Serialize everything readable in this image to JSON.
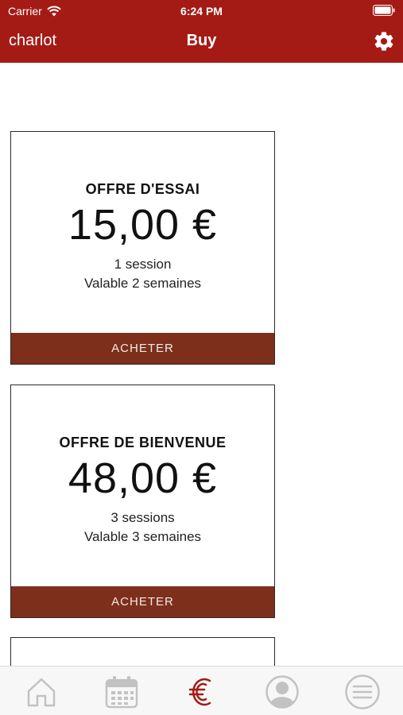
{
  "status_bar": {
    "carrier": "Carrier",
    "time": "6:24 PM",
    "icons": [
      "wifi-icon",
      "battery-icon"
    ]
  },
  "nav": {
    "left_label": "charlot",
    "title": "Buy",
    "settings_icon": "gear-icon"
  },
  "colors": {
    "header": "#a41b15",
    "button": "#7d2f1c",
    "tab_active": "#a41b15",
    "tab_inactive": "#c2c2c2"
  },
  "offers": [
    {
      "title": "OFFRE D'ESSAI",
      "price": "15,00 €",
      "sessions": "1 session",
      "validity": "Valable 2 semaines",
      "button": "ACHETER"
    },
    {
      "title": "OFFRE DE BIENVENUE",
      "price": "48,00 €",
      "sessions": "3 sessions",
      "validity": "Valable 3 semaines",
      "button": "ACHETER"
    }
  ],
  "tab_bar": {
    "tabs": [
      {
        "icon": "home-icon",
        "active": false
      },
      {
        "icon": "calendar-icon",
        "active": false
      },
      {
        "icon": "euro-icon",
        "active": true
      },
      {
        "icon": "profile-icon",
        "active": false
      },
      {
        "icon": "menu-icon",
        "active": false
      }
    ]
  }
}
